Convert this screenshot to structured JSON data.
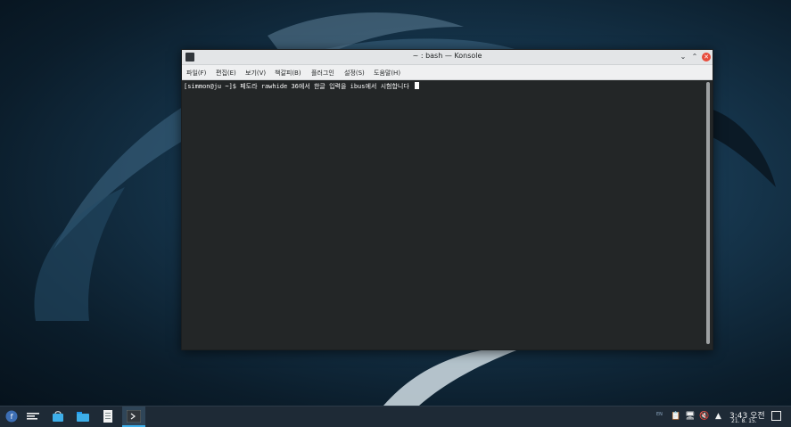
{
  "window": {
    "title": "~ : bash — Konsole",
    "menu": [
      "파일(F)",
      "편집(E)",
      "보기(V)",
      "책갈피(B)",
      "플러그인",
      "설정(S)",
      "도움말(H)"
    ]
  },
  "terminal": {
    "prompt": "[simmon@ju ~]$ ",
    "command": "페도라 rawhide 36에서 한글 입력을 ibus에서 시험합니다 "
  },
  "taskbar": {
    "launcher_icon": "fedora-launcher-icon",
    "tray_keyboard_indicator": "EN",
    "clock_time": "3:43 오전",
    "clock_date": "21. 8. 15."
  }
}
